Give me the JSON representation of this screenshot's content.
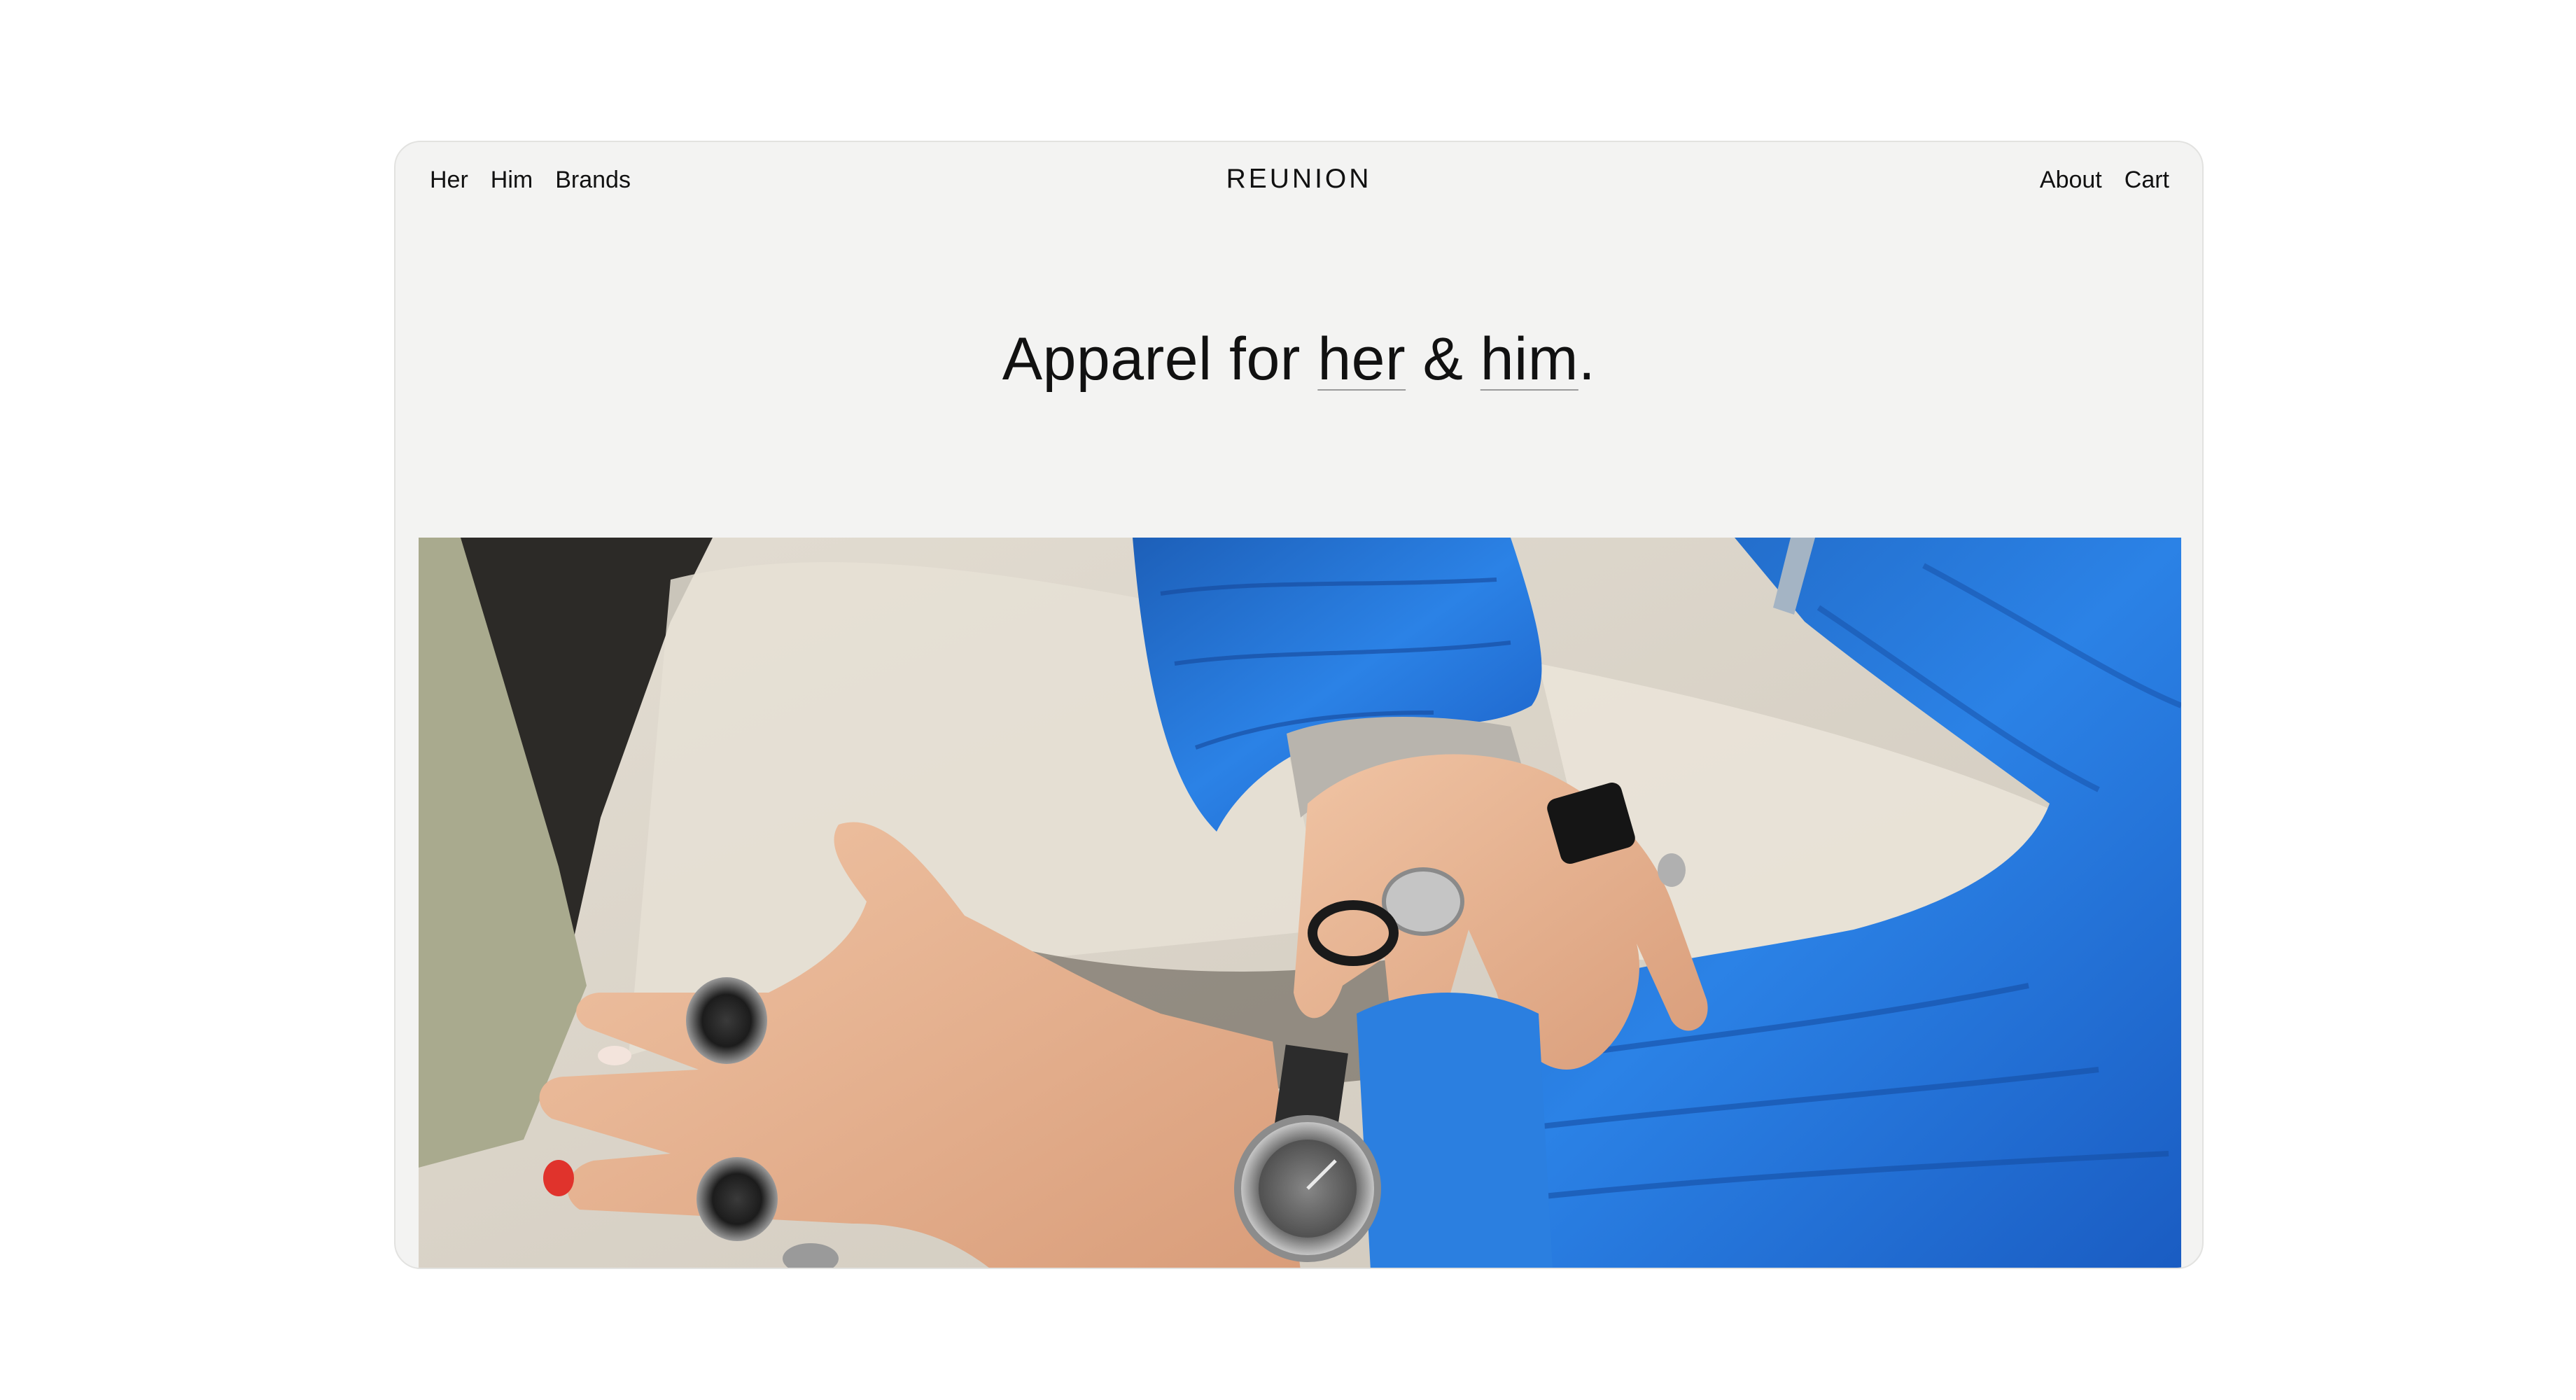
{
  "nav": {
    "left_items": [
      {
        "label": "Her"
      },
      {
        "label": "Him"
      },
      {
        "label": "Brands"
      }
    ],
    "logo": "REUNION",
    "right_items": [
      {
        "label": "About"
      },
      {
        "label": "Cart"
      }
    ]
  },
  "hero": {
    "prefix": "Apparel for ",
    "link_her": "her",
    "amp": " & ",
    "link_him": "him",
    "suffix": "."
  },
  "photo": {
    "subject": "hands-with-rings-and-blue-puffer-jacket",
    "colors": {
      "beige": "#d9d3c8",
      "blue": "#1e6fd6",
      "skin": "#e8b594",
      "dark": "#2a2622",
      "nail_red": "#e0332c",
      "silver": "#b8b8b8"
    }
  }
}
